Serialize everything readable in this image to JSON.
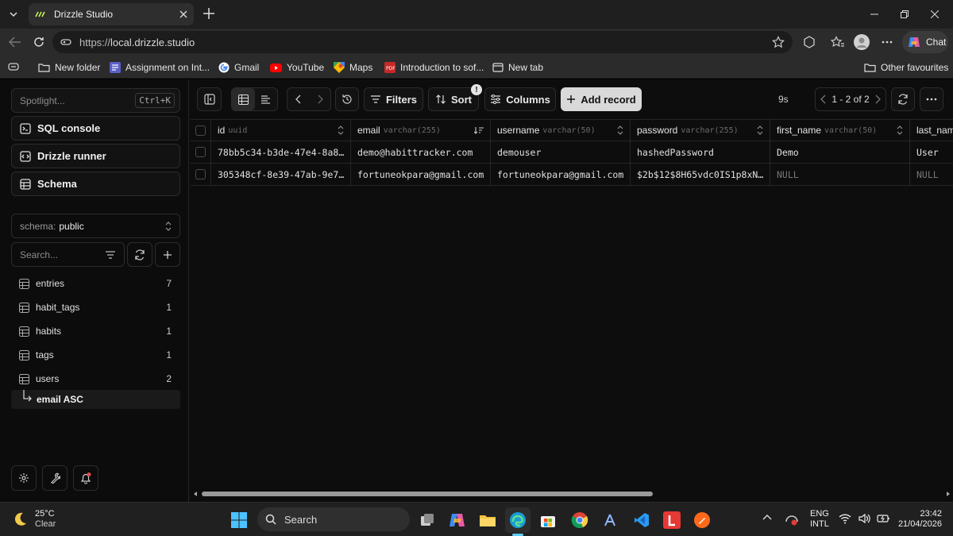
{
  "browser": {
    "tab_title": "Drizzle Studio",
    "url_scheme": "https://",
    "url_host": "local.drizzle.studio",
    "chat_label": "Chat",
    "bookmarks": [
      "New folder",
      "Assignment on Int...",
      "Gmail",
      "YouTube",
      "Maps",
      "Introduction to sof...",
      "New tab"
    ],
    "other_favourites": "Other favourites"
  },
  "sidebar": {
    "spotlight_placeholder": "Spotlight...",
    "spotlight_shortcut": "Ctrl+K",
    "sql_console": "SQL console",
    "drizzle_runner": "Drizzle runner",
    "schema_button": "Schema",
    "schema_key": "schema:",
    "schema_value": "public",
    "search_placeholder": "Search...",
    "tables": [
      {
        "name": "entries",
        "count": "7"
      },
      {
        "name": "habit_tags",
        "count": "1"
      },
      {
        "name": "habits",
        "count": "1"
      },
      {
        "name": "tags",
        "count": "1"
      },
      {
        "name": "users",
        "count": "2"
      }
    ],
    "active_sort": "email ASC"
  },
  "toolbar": {
    "filters": "Filters",
    "sort": "Sort",
    "sort_badge": "!",
    "columns": "Columns",
    "add_record": "Add record",
    "timing": "9s",
    "pager_text": "1 - 2 of 2"
  },
  "grid": {
    "columns": [
      {
        "name": "id",
        "type": "uuid"
      },
      {
        "name": "email",
        "type": "varchar(255)"
      },
      {
        "name": "username",
        "type": "varchar(50)"
      },
      {
        "name": "password",
        "type": "varchar(255)"
      },
      {
        "name": "first_name",
        "type": "varchar(50)"
      },
      {
        "name": "last_nam",
        "type": ""
      }
    ],
    "rows": [
      [
        "78bb5c34-b3de-47e4-8a8…",
        "demo@habittracker.com",
        "demouser",
        "hashedPassword",
        "Demo",
        "User"
      ],
      [
        "305348cf-8e39-47ab-9e7…",
        "fortuneokpara@gmail.com",
        "fortuneokpara@gmail.com",
        "$2b$12$8H65vdc0IS1p8xN…",
        "NULL",
        "NULL"
      ]
    ]
  },
  "taskbar": {
    "weather_temp": "25°C",
    "weather_desc": "Clear",
    "search_label": "Search",
    "lang_top": "ENG",
    "lang_bottom": "INTL",
    "time": "23:42",
    "date": "21/04/2026"
  }
}
